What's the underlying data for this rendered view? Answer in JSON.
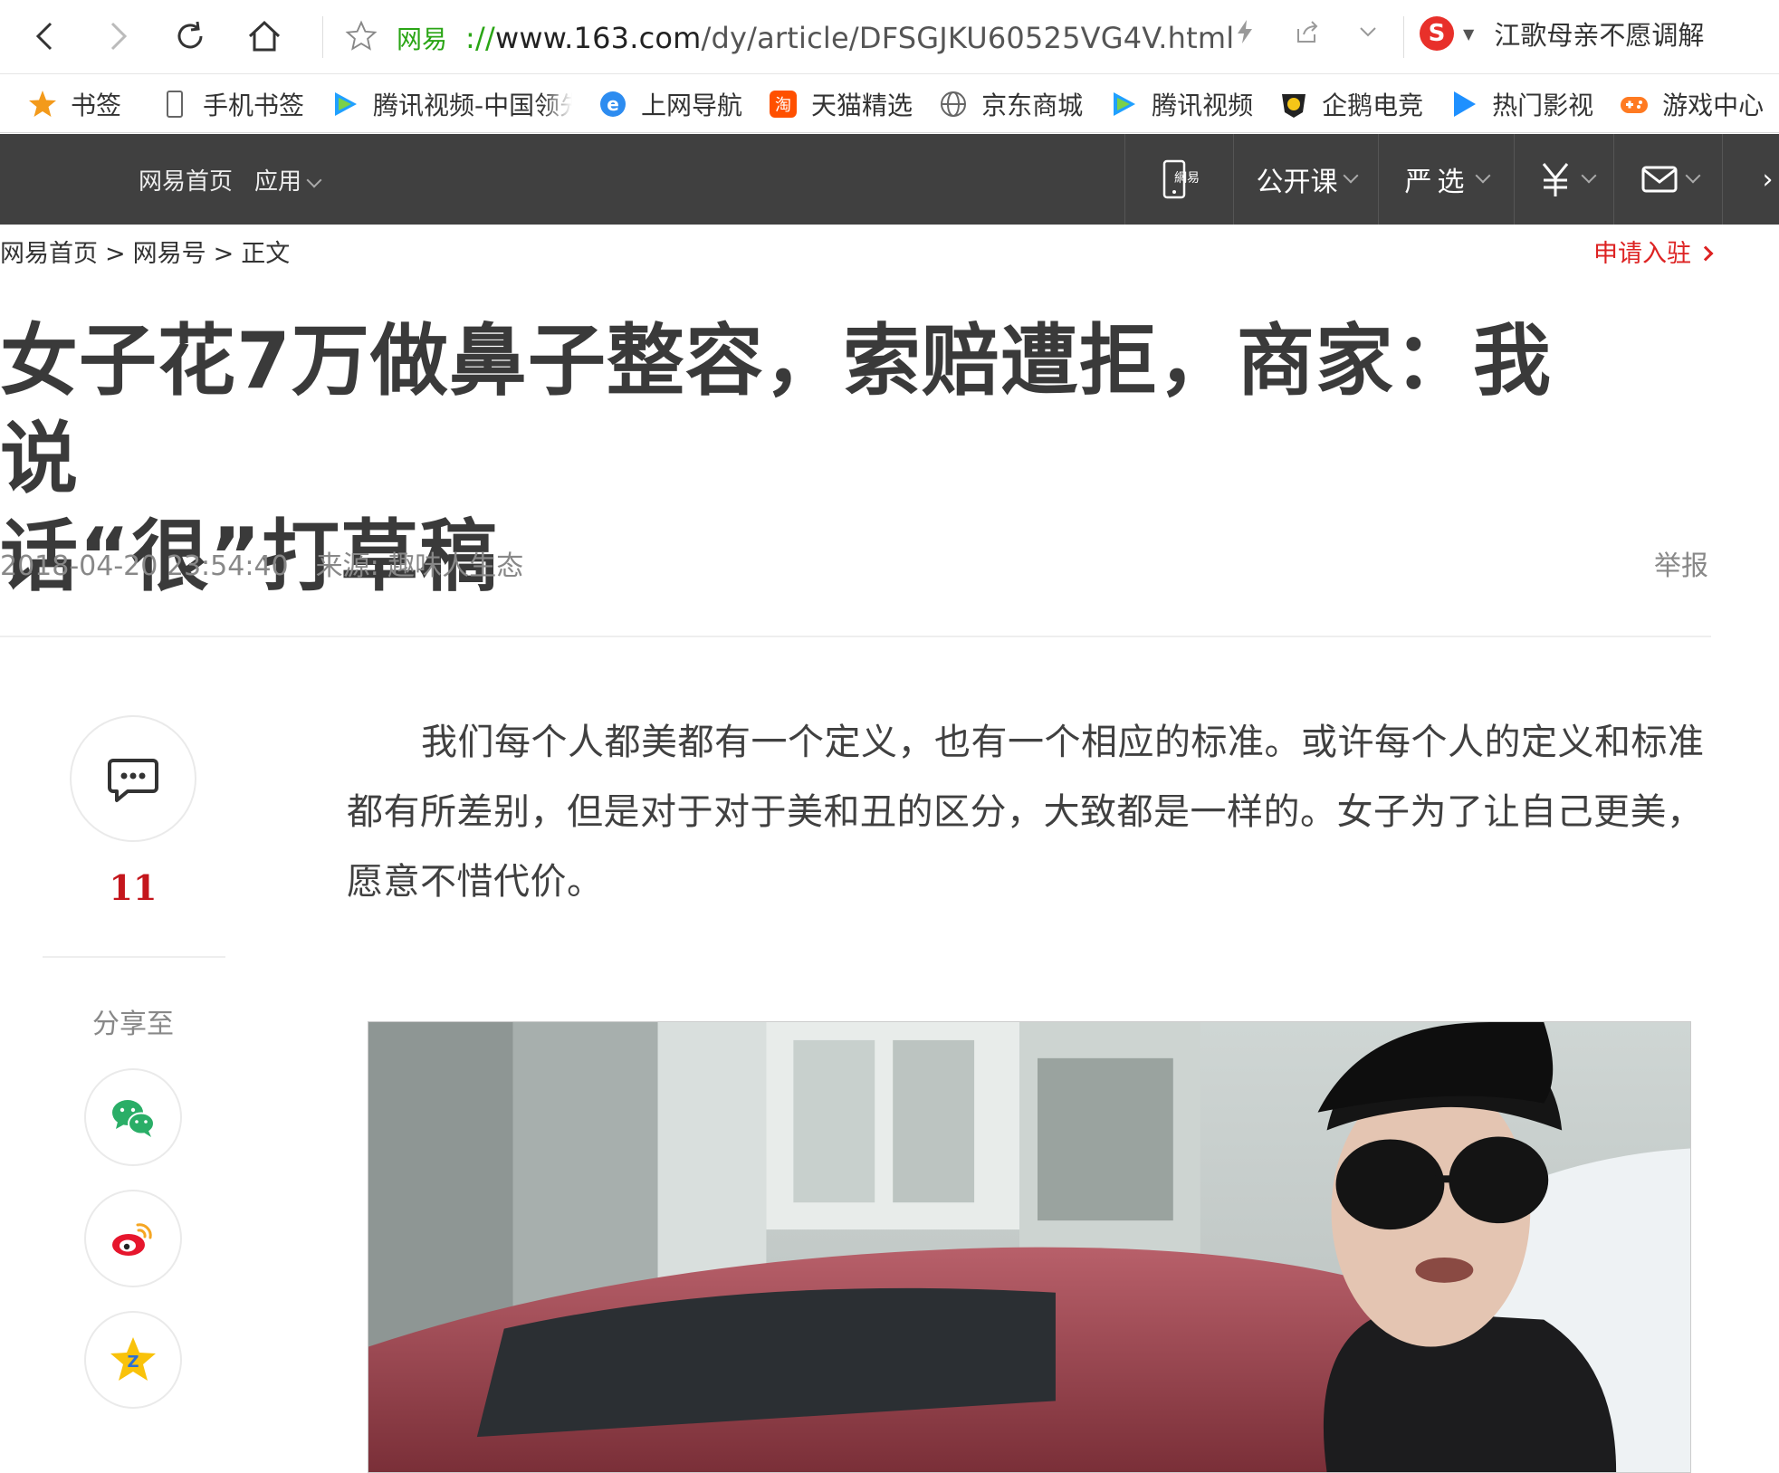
{
  "browser": {
    "site_tag": "网易",
    "url_scheme": "://",
    "url_host": "www.163.com",
    "url_path": "/dy/article/DFSGJKU60525VG4V.html",
    "hot_search": "江歌母亲不愿调解"
  },
  "bookmarks": {
    "favorites_label": "书签",
    "items": [
      {
        "label": "手机书签",
        "icon": "phone-icon"
      },
      {
        "label": "腾讯视频-中国领先",
        "icon": "tencent-video-icon"
      },
      {
        "label": "上网导航",
        "icon": "ie-icon"
      },
      {
        "label": "天猫精选",
        "icon": "taobao-icon"
      },
      {
        "label": "京东商城",
        "icon": "globe-icon"
      },
      {
        "label": "腾讯视频",
        "icon": "tencent-video-icon"
      },
      {
        "label": "企鹅电竞",
        "icon": "esports-icon"
      },
      {
        "label": "热门影视",
        "icon": "play-icon"
      },
      {
        "label": "游戏中心",
        "icon": "gamepad-icon"
      }
    ]
  },
  "site_nav": {
    "home": "网易首页",
    "apps": "应用",
    "open_course": "公开课",
    "yanxuan": "严选"
  },
  "breadcrumb": {
    "home": "网易首页",
    "section": "网易号",
    "current": "正文",
    "sep": ">"
  },
  "apply_link": "申请入驻",
  "article": {
    "title_line1": "女子花7万做鼻子整容，索赔遭拒，商家：我说",
    "title_line2": "话“很”打草稿",
    "datetime": "2018-04-20 23:54:40",
    "source": "来源: 趣味人生态",
    "report": "举报",
    "paragraph": "我们每个人都美都有一个定义，也有一个相应的标准。或许每个人的定义和标准都有所差别，但是对于对于美和丑的区分，大致都是一样的。女子为了让自己更美，愿意不惜代价。"
  },
  "side_rail": {
    "comment_count": "11",
    "share_label": "分享至"
  },
  "colors": {
    "nav_bg": "#404040",
    "accent_red": "#c4161c",
    "link_green": "#2aa515"
  }
}
